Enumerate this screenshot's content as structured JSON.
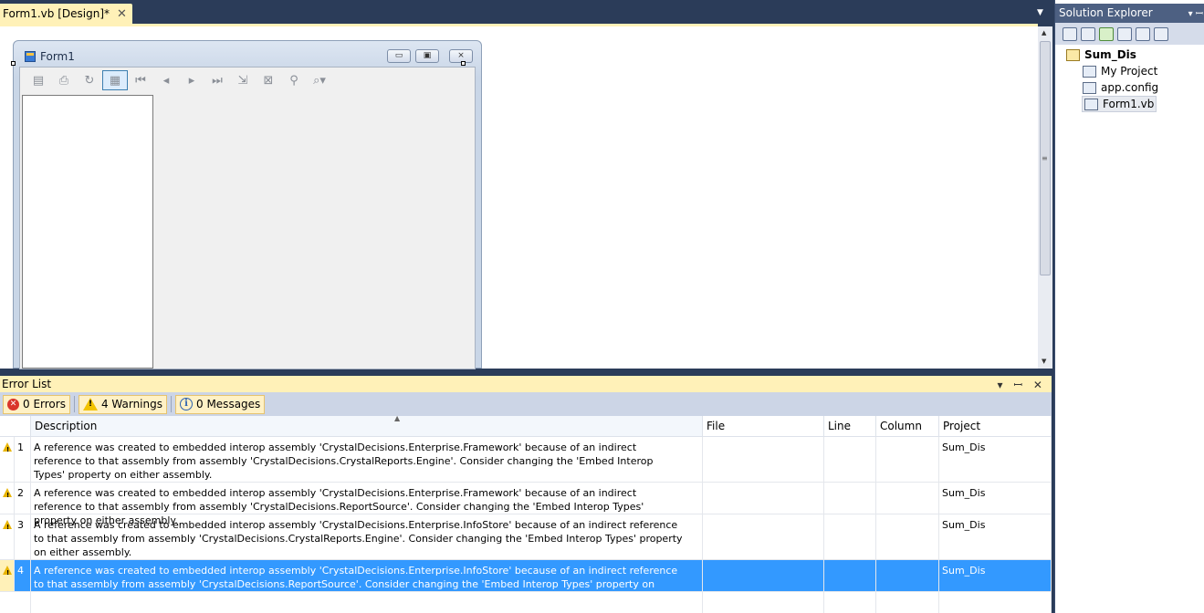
{
  "doc_tab": {
    "title": "Form1.vb [Design]*",
    "close": "✕"
  },
  "form1": {
    "title": "Form1",
    "min": "▭",
    "max": "▣",
    "close": "⨯"
  },
  "form_toolbar": {
    "icons": [
      "export-icon",
      "print-icon",
      "refresh-icon",
      "toggle-tree-icon",
      "first-page-icon",
      "prev-page-icon",
      "next-page-icon",
      "last-page-icon",
      "goto-page-icon",
      "close-view-icon",
      "find-icon",
      "zoom-icon"
    ]
  },
  "error_list": {
    "title": "Error List",
    "title_buttons": "▾ ꟷ ✕",
    "filters": {
      "errors": "0 Errors",
      "warnings": "4 Warnings",
      "messages": "0 Messages"
    },
    "columns": {
      "description": "Description",
      "file": "File",
      "line": "Line",
      "column": "Column",
      "project": "Project"
    },
    "rows": [
      {
        "num": "1",
        "description": "A reference was created to embedded interop assembly 'CrystalDecisions.Enterprise.Framework' because of an indirect reference to that assembly from assembly 'CrystalDecisions.CrystalReports.Engine'. Consider changing the 'Embed Interop Types' property on either assembly.",
        "file": "",
        "line": "",
        "column": "",
        "project": "Sum_Dis"
      },
      {
        "num": "2",
        "description": "A reference was created to embedded interop assembly 'CrystalDecisions.Enterprise.Framework' because of an indirect reference to that assembly from assembly 'CrystalDecisions.ReportSource'. Consider changing the 'Embed Interop Types' property on either assembly.",
        "file": "",
        "line": "",
        "column": "",
        "project": "Sum_Dis"
      },
      {
        "num": "3",
        "description": "A reference was created to embedded interop assembly 'CrystalDecisions.Enterprise.InfoStore' because of an indirect reference to that assembly from assembly 'CrystalDecisions.CrystalReports.Engine'. Consider changing the 'Embed Interop Types' property on either assembly.",
        "file": "",
        "line": "",
        "column": "",
        "project": "Sum_Dis"
      },
      {
        "num": "4",
        "description": "A reference was created to embedded interop assembly 'CrystalDecisions.Enterprise.InfoStore' because of an indirect reference to that assembly from assembly 'CrystalDecisions.ReportSource'. Consider changing the 'Embed Interop Types' property on either assembly.",
        "file": "",
        "line": "",
        "column": "",
        "project": "Sum_Dis"
      }
    ]
  },
  "solution_explorer": {
    "title": "Solution Explorer",
    "title_buttons": "▾ ꟷ",
    "solution": "Sum_Dis",
    "items": [
      "My Project",
      "app.config",
      "Form1.vb"
    ]
  },
  "colors": {
    "accent_yellow": "#fff1b8",
    "selection_blue": "#3399ff",
    "chrome_dark": "#2b3c59"
  }
}
